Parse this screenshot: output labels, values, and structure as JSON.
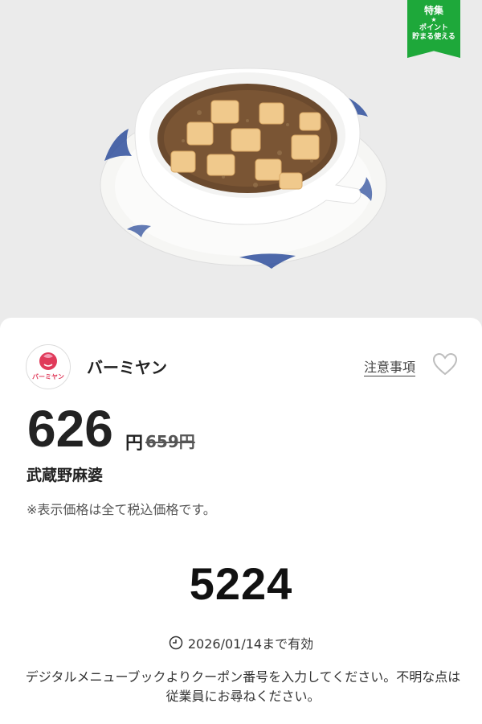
{
  "badge": {
    "title": "特集",
    "star": "★",
    "subtitle_line1": "ポイント",
    "subtitle_line2": "貯まる使える"
  },
  "store": {
    "name": "バーミヤン",
    "logo_text": "バーミヤン"
  },
  "notes_label": "注意事項",
  "price": {
    "current": "626",
    "unit": "円",
    "original": "659円"
  },
  "item": {
    "name": "武蔵野麻婆"
  },
  "tax_note": "※表示価格は全て税込価格です。",
  "coupon": {
    "code": "5224"
  },
  "validity": {
    "text": "2026/01/14まで有効"
  },
  "instructions": "デジタルメニューブックよりクーポン番号を入力してください。不明な点は従業員にお尋ねください。",
  "colors": {
    "badge_green": "#1ea83a",
    "logo_red": "#e03a5a",
    "logo_pink": "#f29cb4",
    "tofu": "#f0c98c",
    "sauce": "#6b4a2e"
  }
}
